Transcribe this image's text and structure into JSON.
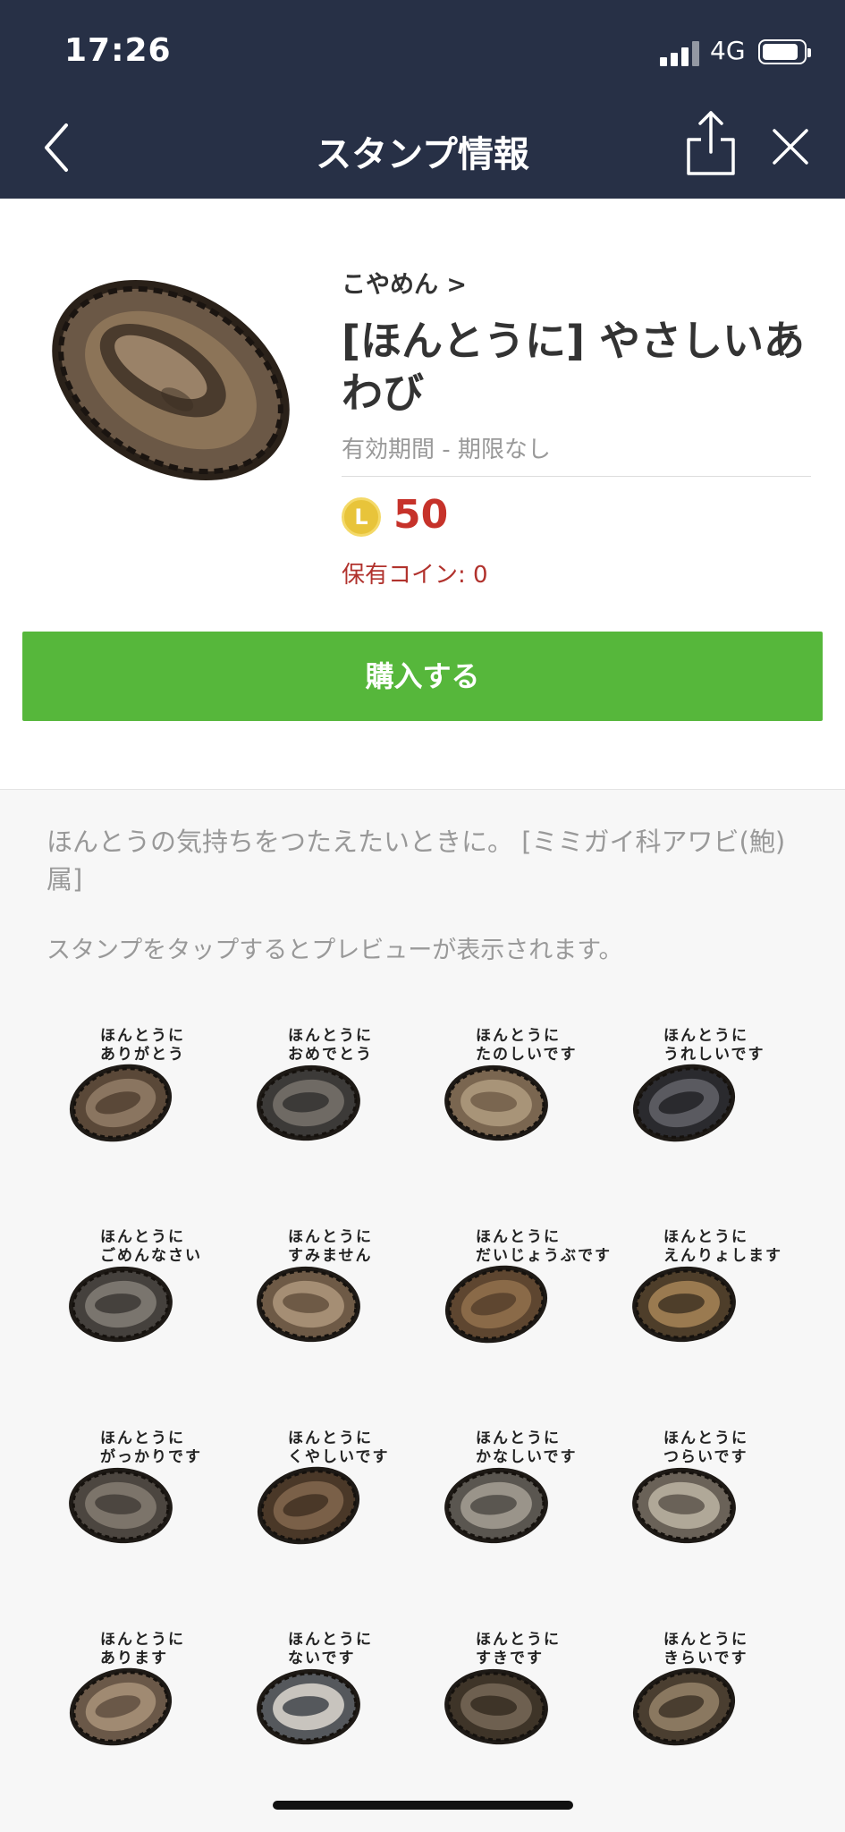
{
  "status_bar": {
    "time": "17:26",
    "network": "4G"
  },
  "nav": {
    "title": "スタンプ情報"
  },
  "package": {
    "author": "こやめん >",
    "title": "[ほんとうに] やさしいあわび",
    "validity": "有効期間 - 期限なし",
    "coin_symbol": "L",
    "price": "50",
    "owned_coins": "保有コイン: 0",
    "buy_label": "購入する"
  },
  "description": "ほんとうの気持ちをつたえたいときに。 [ミミガイ科アワビ(鮑)属]",
  "preview_hint": "スタンプをタップするとプレビューが表示されます。",
  "stickers": [
    {
      "line1": "ほんとうに",
      "line2": "ありがとう",
      "shell": "#5a4838",
      "inner": "#8a7560"
    },
    {
      "line1": "ほんとうに",
      "line2": "おめでとう",
      "shell": "#3c3a38",
      "inner": "#6f6a64"
    },
    {
      "line1": "ほんとうに",
      "line2": "たのしいです",
      "shell": "#7a6650",
      "inner": "#a89478"
    },
    {
      "line1": "ほんとうに",
      "line2": "うれしいです",
      "shell": "#2a2a2e",
      "inner": "#5a5a60"
    },
    {
      "line1": "ほんとうに",
      "line2": "ごめんなさい",
      "shell": "#45413d",
      "inner": "#7a756e"
    },
    {
      "line1": "ほんとうに",
      "line2": "すみません",
      "shell": "#6e5a46",
      "inner": "#a58e74"
    },
    {
      "line1": "ほんとうに",
      "line2": "だいじょうぶです",
      "shell": "#5e4630",
      "inner": "#8a6a48"
    },
    {
      "line1": "ほんとうに",
      "line2": "えんりょします",
      "shell": "#4e3e2a",
      "inner": "#9a7a50"
    },
    {
      "line1": "ほんとうに",
      "line2": "がっかりです",
      "shell": "#4c4640",
      "inner": "#7c746a"
    },
    {
      "line1": "ほんとうに",
      "line2": "くやしいです",
      "shell": "#4a3828",
      "inner": "#7a6048"
    },
    {
      "line1": "ほんとうに",
      "line2": "かなしいです",
      "shell": "#5a5650",
      "inner": "#9a948a"
    },
    {
      "line1": "ほんとうに",
      "line2": "つらいです",
      "shell": "#6a6258",
      "inner": "#b0a898"
    },
    {
      "line1": "ほんとうに",
      "line2": "あります",
      "shell": "#6a5848",
      "inner": "#a08a72"
    },
    {
      "line1": "ほんとうに",
      "line2": "ないです",
      "shell": "#55585c",
      "inner": "#c8c4be"
    },
    {
      "line1": "ほんとうに",
      "line2": "すきです",
      "shell": "#3e3428",
      "inner": "#6e6050"
    },
    {
      "line1": "ほんとうに",
      "line2": "きらいです",
      "shell": "#4a3e30",
      "inner": "#8a7860"
    }
  ]
}
